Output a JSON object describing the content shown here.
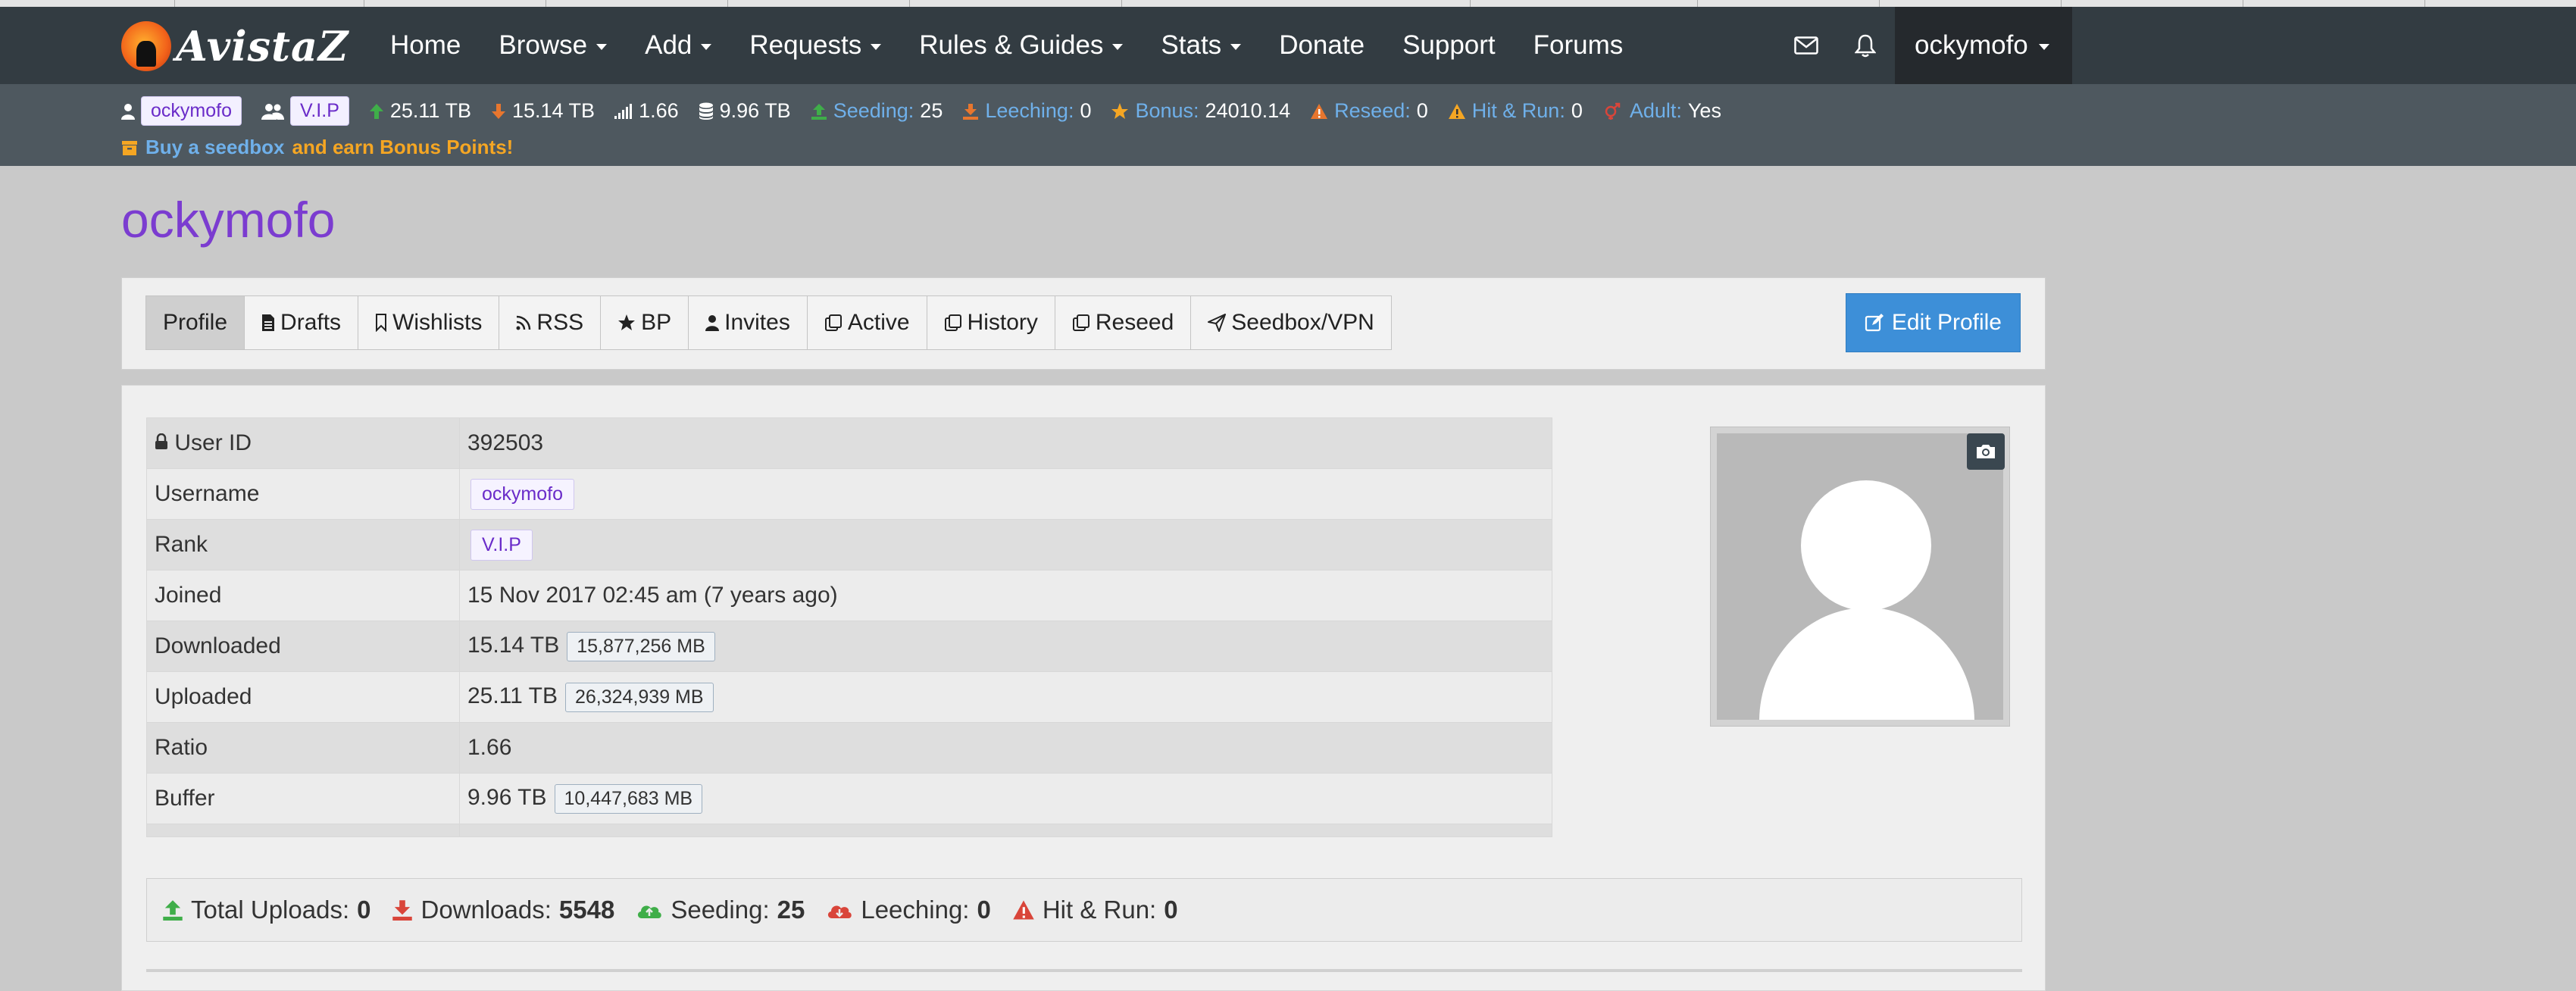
{
  "site": {
    "brand": "AvistaZ"
  },
  "nav": {
    "items": [
      {
        "label": "Home",
        "dropdown": false
      },
      {
        "label": "Browse",
        "dropdown": true
      },
      {
        "label": "Add",
        "dropdown": true
      },
      {
        "label": "Requests",
        "dropdown": true
      },
      {
        "label": "Rules & Guides",
        "dropdown": true
      },
      {
        "label": "Stats",
        "dropdown": true
      },
      {
        "label": "Donate",
        "dropdown": false
      },
      {
        "label": "Support",
        "dropdown": false
      },
      {
        "label": "Forums",
        "dropdown": false
      }
    ],
    "user": "ockymofo"
  },
  "statusbar": {
    "username": "ockymofo",
    "group": "V.I.P",
    "uploaded": "25.11 TB",
    "downloaded": "15.14 TB",
    "ratio": "1.66",
    "buffer": "9.96 TB",
    "seeding_label": "Seeding:",
    "seeding": "25",
    "leeching_label": "Leeching:",
    "leeching": "0",
    "bonus_label": "Bonus:",
    "bonus": "24010.14",
    "reseed_label": "Reseed:",
    "reseed": "0",
    "hnr_label": "Hit & Run:",
    "hnr": "0",
    "adult_label": "Adult:",
    "adult": "Yes",
    "promo_prefix": "Buy a seedbox",
    "promo_suffix": "and earn Bonus Points!"
  },
  "page": {
    "title": "ockymofo"
  },
  "tabs": [
    {
      "label": "Profile",
      "icon": "none"
    },
    {
      "label": "Drafts",
      "icon": "file-icon"
    },
    {
      "label": "Wishlists",
      "icon": "bookmark-icon"
    },
    {
      "label": "RSS",
      "icon": "rss-icon"
    },
    {
      "label": "BP",
      "icon": "star-icon"
    },
    {
      "label": "Invites",
      "icon": "user-icon"
    },
    {
      "label": "Active",
      "icon": "clipboard-icon"
    },
    {
      "label": "History",
      "icon": "clipboard-icon"
    },
    {
      "label": "Reseed",
      "icon": "clipboard-icon"
    },
    {
      "label": "Seedbox/VPN",
      "icon": "paper-plane-icon"
    }
  ],
  "edit_profile": "Edit Profile",
  "profile": {
    "rows": [
      {
        "key": "User ID",
        "value": "392503"
      },
      {
        "key": "Username",
        "value": "ockymofo"
      },
      {
        "key": "Rank",
        "value": "V.I.P"
      },
      {
        "key": "Joined",
        "value": "15 Nov 2017 02:45 am (7 years ago)"
      },
      {
        "key": "Downloaded",
        "value": "15.14 TB",
        "detail": "15,877,256 MB"
      },
      {
        "key": "Uploaded",
        "value": "25.11 TB",
        "detail": "26,324,939 MB"
      },
      {
        "key": "Ratio",
        "value": "1.66"
      },
      {
        "key": "Buffer",
        "value": "9.96 TB",
        "detail": "10,447,683 MB"
      }
    ]
  },
  "summary": {
    "uploads_label": "Total Uploads:",
    "uploads": "0",
    "downloads_label": "Downloads:",
    "downloads": "5548",
    "seeding_label": "Seeding:",
    "seeding": "25",
    "leeching_label": "Leeching:",
    "leeching": "0",
    "hnr_label": "Hit & Run:",
    "hnr": "0"
  },
  "colors": {
    "navbar": "#333c42",
    "statusbar": "#4e585f",
    "accent_purple": "#7b3cd0",
    "primary_button": "#3d8fd8",
    "green": "#3fae49",
    "orange": "#e8762e",
    "red": "#d9453a",
    "yellow": "#f5a623",
    "blue_label": "#6fb0ea"
  }
}
